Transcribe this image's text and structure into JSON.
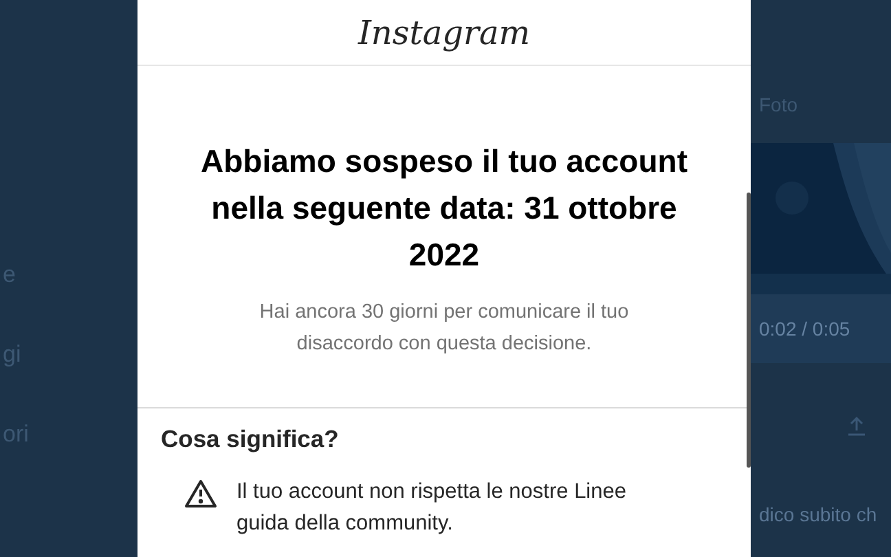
{
  "background": {
    "left_texts": [
      "e",
      "gi",
      "ori"
    ],
    "right": {
      "label": "Foto",
      "video": {
        "kind": "picture",
        "time": "0:02 / 0:05"
      },
      "caption": "dico subito ch"
    }
  },
  "modal": {
    "logo": "Instagram",
    "title": "Abbiamo sospeso il tuo account nella seguente data: 31 ottobre 2022",
    "subtitle": "Hai ancora 30 giorni per comunicare il tuo disaccordo con questa decisione.",
    "section_title": "Cosa significa?",
    "items": [
      {
        "kind": "warning",
        "text": "Il tuo account non rispetta le nostre Linee guida della community."
      }
    ]
  }
}
